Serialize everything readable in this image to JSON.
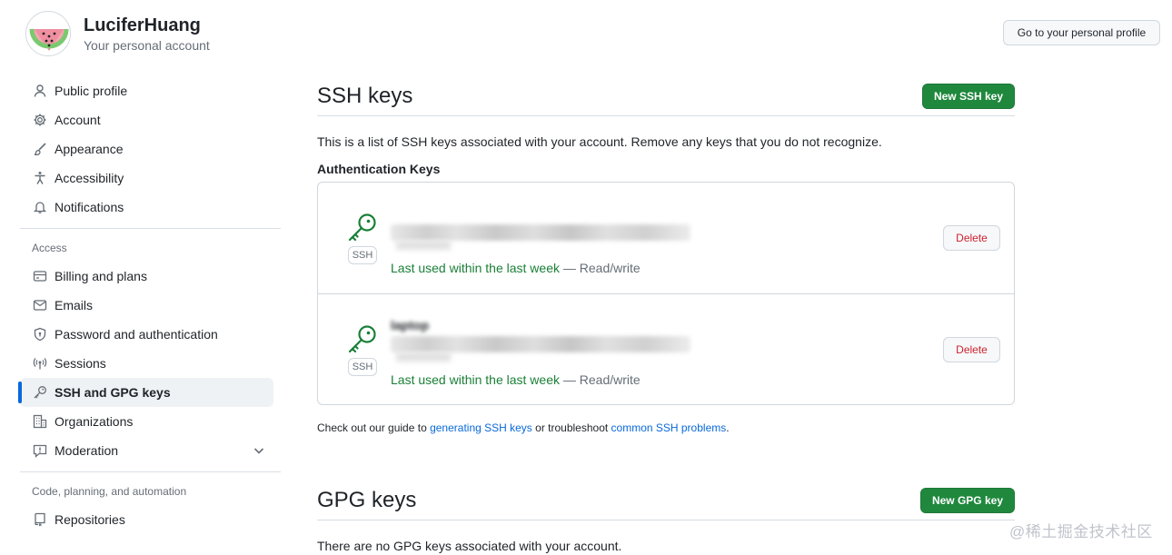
{
  "header": {
    "account_name": "LuciferHuang",
    "account_subtitle": "Your personal account",
    "profile_button": "Go to your personal profile"
  },
  "sidebar": {
    "top_items": [
      {
        "label": "Public profile",
        "icon": "person-icon"
      },
      {
        "label": "Account",
        "icon": "gear-icon"
      },
      {
        "label": "Appearance",
        "icon": "paintbrush-icon"
      },
      {
        "label": "Accessibility",
        "icon": "accessibility-icon"
      },
      {
        "label": "Notifications",
        "icon": "bell-icon"
      }
    ],
    "access_title": "Access",
    "access_items": [
      {
        "label": "Billing and plans",
        "icon": "credit-card-icon"
      },
      {
        "label": "Emails",
        "icon": "mail-icon"
      },
      {
        "label": "Password and authentication",
        "icon": "shield-lock-icon"
      },
      {
        "label": "Sessions",
        "icon": "broadcast-icon"
      },
      {
        "label": "SSH and GPG keys",
        "icon": "key-icon",
        "active": true
      },
      {
        "label": "Organizations",
        "icon": "organization-icon"
      },
      {
        "label": "Moderation",
        "icon": "report-icon"
      }
    ],
    "code_title": "Code, planning, and automation",
    "code_items": [
      {
        "label": "Repositories",
        "icon": "repo-icon"
      }
    ]
  },
  "ssh": {
    "title": "SSH keys",
    "new_button": "New SSH key",
    "description": "This is a list of SSH keys associated with your account. Remove any keys that you do not recognize.",
    "auth_heading": "Authentication Keys",
    "keys": [
      {
        "badge": "SSH",
        "title": "",
        "last_used": "Last used within the last week",
        "access": "— Read/write",
        "delete_label": "Delete"
      },
      {
        "badge": "SSH",
        "title": "laptop",
        "last_used": "Last used within the last week",
        "access": "— Read/write",
        "delete_label": "Delete"
      }
    ],
    "guide_prefix": "Check out our guide to ",
    "guide_link1": "generating SSH keys",
    "guide_middle": " or troubleshoot ",
    "guide_link2": "common SSH problems",
    "guide_suffix": "."
  },
  "gpg": {
    "title": "GPG keys",
    "new_button": "New GPG key",
    "empty_text": "There are no GPG keys associated with your account."
  },
  "watermark": "@稀土掘金技术社区",
  "colors": {
    "green_button": "#1f883d",
    "link": "#0969da",
    "danger": "#cf222e",
    "success_text": "#1a7f37",
    "active_bar": "#0969da"
  }
}
